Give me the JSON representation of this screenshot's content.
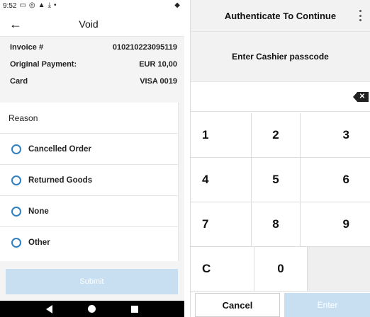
{
  "status_bar": {
    "time": "9:52"
  },
  "void_screen": {
    "title": "Void",
    "info": [
      {
        "label": "Invoice #",
        "value": "010210223095119"
      },
      {
        "label": "Original Payment:",
        "value": "EUR 10,00"
      },
      {
        "label": "Card",
        "value": "VISA 0019"
      }
    ],
    "reason_header": "Reason",
    "options": [
      {
        "label": "Cancelled Order"
      },
      {
        "label": "Returned Goods"
      },
      {
        "label": "None"
      },
      {
        "label": "Other"
      }
    ],
    "submit_label": "Submit"
  },
  "auth_screen": {
    "title": "Authenticate To Continue",
    "prompt": "Enter Cashier passcode",
    "keys": [
      [
        "1",
        "2",
        "3"
      ],
      [
        "4",
        "5",
        "6"
      ],
      [
        "7",
        "8",
        "9"
      ],
      [
        "C",
        "0",
        ""
      ]
    ],
    "cancel_label": "Cancel",
    "enter_label": "Enter"
  },
  "colors": {
    "accent": "#2f7fc4",
    "disabled_button": "#c7dff0"
  }
}
